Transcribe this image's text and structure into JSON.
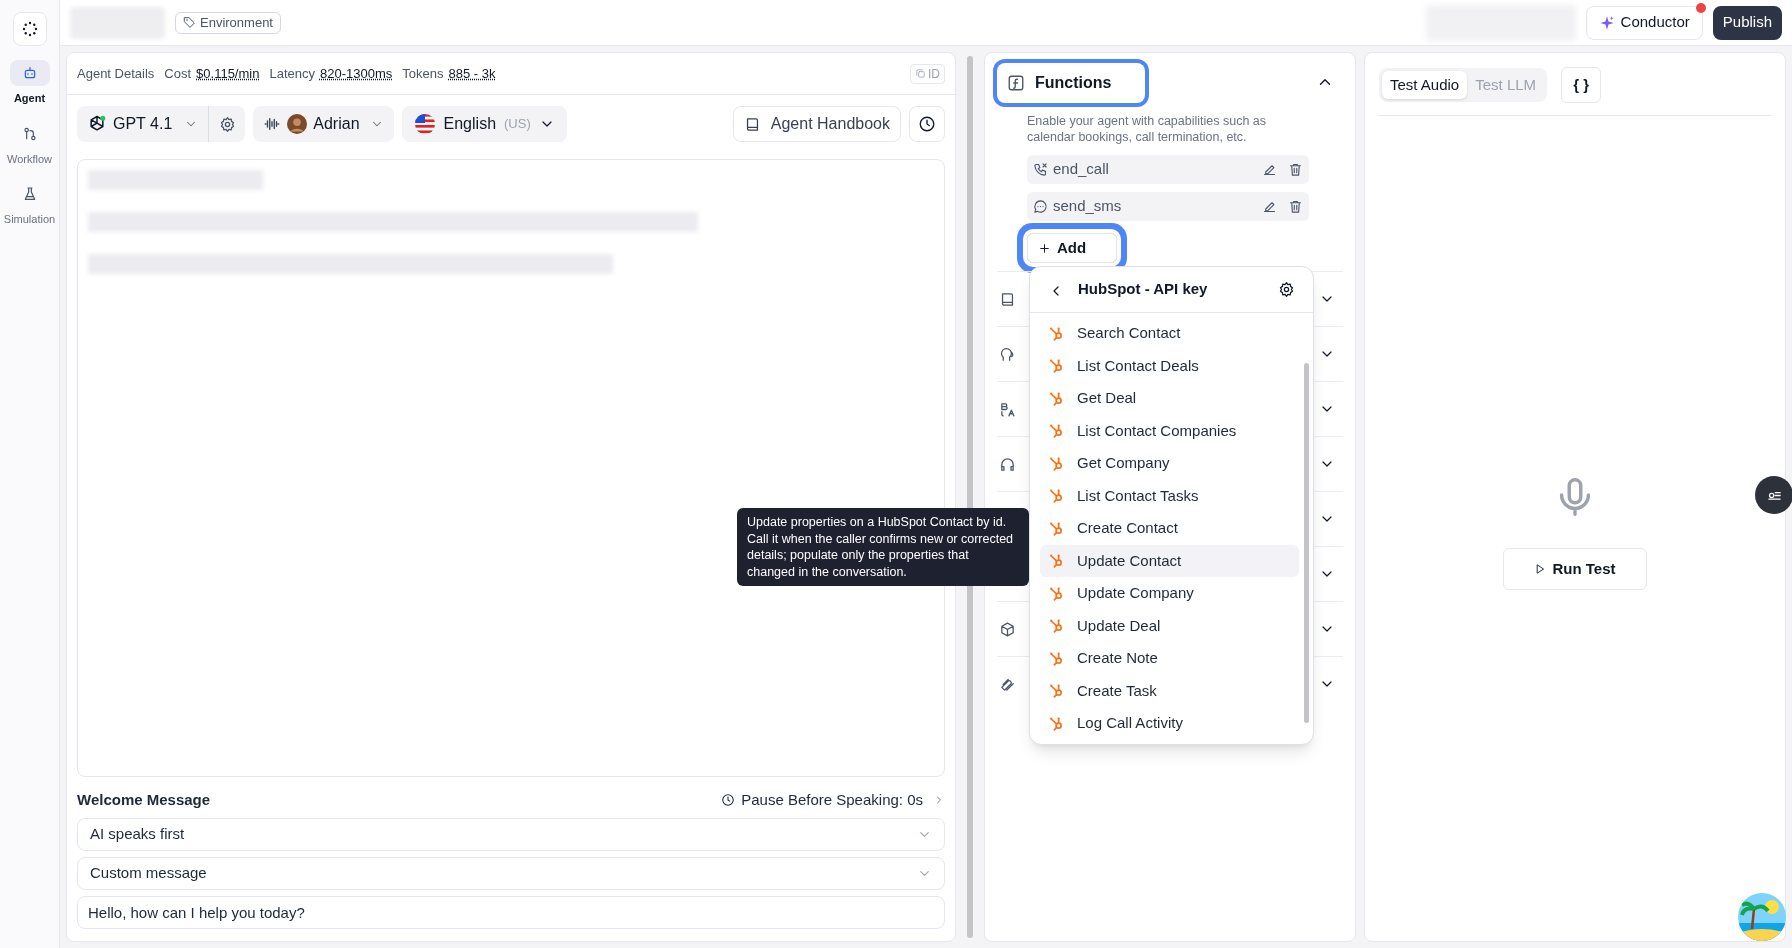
{
  "sidebar": {
    "items": [
      {
        "label": "Agent",
        "kind": "robot",
        "selected": true
      },
      {
        "label": "Workflow",
        "kind": "flow",
        "selected": false
      },
      {
        "label": "Simulation",
        "kind": "flask",
        "selected": false
      }
    ]
  },
  "top_bar": {
    "tag": "Environment",
    "conductor": {
      "label": "Conductor",
      "notification": true
    },
    "publish": "Publish"
  },
  "agent_details": {
    "label": "Agent Details",
    "metrics": [
      {
        "label": "Cost",
        "value": "$0.115/min"
      },
      {
        "label": "Latency",
        "value": "820-1300ms"
      },
      {
        "label": "Tokens",
        "value": "885 - 3k"
      }
    ],
    "id_button": "ID"
  },
  "controls": {
    "model": "GPT 4.1",
    "voice": "Adrian",
    "language": "English",
    "region": "(US)",
    "handbook": "Agent Handbook"
  },
  "welcome": {
    "title": "Welcome Message",
    "pause": "Pause Before Speaking: 0s",
    "selects": [
      "AI speaks first",
      "Custom message"
    ],
    "message": "Hello, how can I help you today?"
  },
  "functions": {
    "title": "Functions",
    "highlighted": true,
    "expanded": true,
    "description": "Enable your agent with capabilities such as calendar bookings, call termination, etc.",
    "items": [
      {
        "name": "end_call",
        "kind": "call"
      },
      {
        "name": "send_sms",
        "kind": "sms"
      }
    ],
    "add": {
      "label": "Add",
      "highlighted": true
    }
  },
  "sections": [
    {
      "kind": "book"
    },
    {
      "kind": "speech"
    },
    {
      "kind": "translate"
    },
    {
      "kind": "headphones"
    },
    {
      "kind": "hidden"
    },
    {
      "kind": "hidden"
    },
    {
      "kind": "cube"
    },
    {
      "kind": "clip"
    }
  ],
  "dropdown": {
    "title": "HubSpot - API key",
    "items": [
      {
        "label": "Search Contact",
        "selected": false
      },
      {
        "label": "List Contact Deals",
        "selected": false
      },
      {
        "label": "Get Deal",
        "selected": false
      },
      {
        "label": "List Contact Companies",
        "selected": false
      },
      {
        "label": "Get Company",
        "selected": false
      },
      {
        "label": "List Contact Tasks",
        "selected": false
      },
      {
        "label": "Create Contact",
        "selected": false
      },
      {
        "label": "Update Contact",
        "selected": true
      },
      {
        "label": "Update Company",
        "selected": false
      },
      {
        "label": "Update Deal",
        "selected": false
      },
      {
        "label": "Create Note",
        "selected": false
      },
      {
        "label": "Create Task",
        "selected": false
      },
      {
        "label": "Log Call Activity",
        "selected": false
      }
    ]
  },
  "tooltip": "Update properties on a HubSpot Contact by id. Call it when the caller confirms new or corrected details; populate only the properties that changed in the conversation.",
  "test": {
    "tabs": [
      {
        "label": "Test Audio",
        "selected": true
      },
      {
        "label": "Test LLM",
        "selected": false
      }
    ],
    "json_button": "{ }",
    "run": "Run Test"
  }
}
